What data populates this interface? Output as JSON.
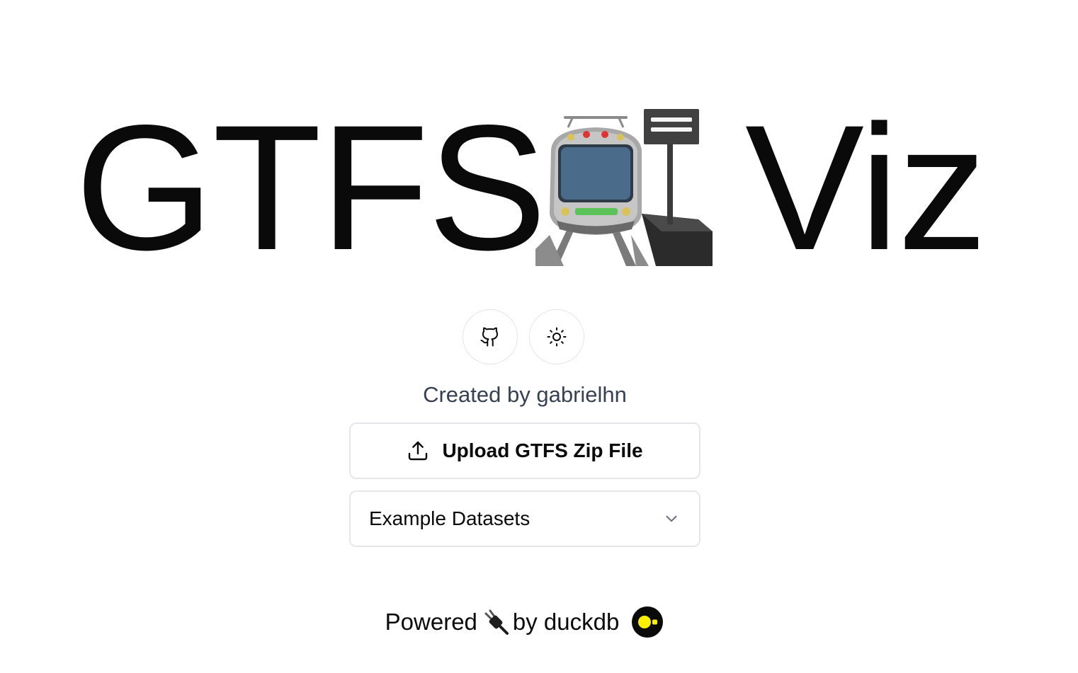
{
  "hero": {
    "title_left": "GTFS",
    "title_right": "Viz",
    "emoji_icon": "station-train-emoji-icon"
  },
  "actions": {
    "github_icon": "github-icon",
    "theme_icon": "sun-icon"
  },
  "credit": {
    "text": "Created by gabrielhn"
  },
  "upload": {
    "label": "Upload GTFS Zip File",
    "icon": "upload-icon"
  },
  "datasets": {
    "selected": "Example Datasets",
    "icon": "chevron-down-icon"
  },
  "footer": {
    "powered": "Powered",
    "by": "by duckdb",
    "plug_icon": "electric-plug-icon",
    "logo_icon": "duckdb-logo-icon"
  },
  "colors": {
    "text": "#0a0a0a",
    "muted": "#374151",
    "border": "#e5e7eb",
    "duckdb_yellow": "#fff000"
  }
}
